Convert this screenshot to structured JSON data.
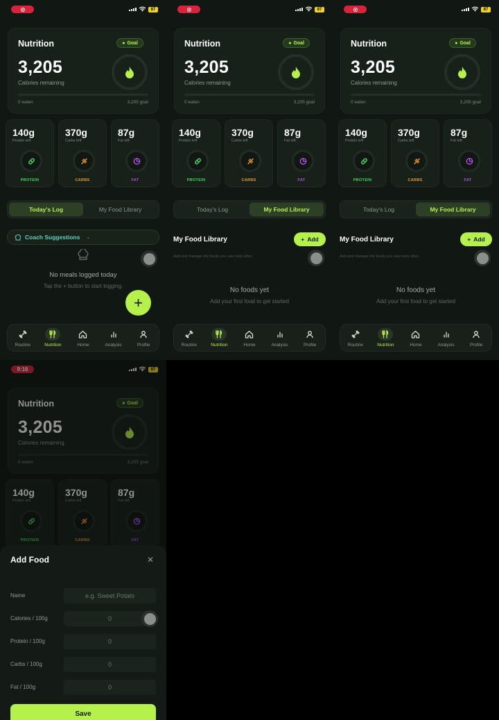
{
  "status": {
    "time": "9:16",
    "battery": "87"
  },
  "summary": {
    "title": "Nutrition",
    "goal_badge": "Goal",
    "calories": "3,205",
    "calories_label": "Calories remaining",
    "eaten": "0 eaten",
    "goal": "3,205 goal",
    "progress": 0
  },
  "macros": [
    {
      "value": "140g",
      "sub": "Protein left",
      "label": "PROTEIN",
      "color": "#3ddc5a",
      "icon": "pill-icon"
    },
    {
      "value": "370g",
      "sub": "Carbs left",
      "label": "CARBS",
      "color": "#f39a2b",
      "icon": "wheat-icon"
    },
    {
      "value": "87g",
      "sub": "Fat left",
      "label": "FAT",
      "color": "#c04bf0",
      "icon": "pie-icon"
    }
  ],
  "tabs": {
    "log": "Today's Log",
    "library": "My Food Library"
  },
  "log": {
    "coach": "Coach Suggestions",
    "empty_title": "No meals logged today",
    "empty_sub": "Tap the + button to start logging."
  },
  "library": {
    "title": "My Food Library",
    "subtitle": "Add and manage the foods you use most often",
    "add": "Add",
    "empty_title": "No foods yet",
    "empty_sub": "Add your first food to get started"
  },
  "nav": [
    "Routine",
    "Nutrition",
    "Home",
    "Analysis",
    "Profile"
  ],
  "add_food": {
    "title": "Add Food",
    "fields": [
      {
        "label": "Name",
        "placeholder": "e.g. Sweet Potato"
      },
      {
        "label": "Calories / 100g",
        "placeholder": "0"
      },
      {
        "label": "Protein / 100g",
        "placeholder": "0"
      },
      {
        "label": "Carbs / 100g",
        "placeholder": "0"
      },
      {
        "label": "Fat / 100g",
        "placeholder": "0"
      }
    ],
    "save": "Save"
  },
  "colors": {
    "accent": "#b6f04a",
    "background": "#111713",
    "card": "#172019"
  }
}
